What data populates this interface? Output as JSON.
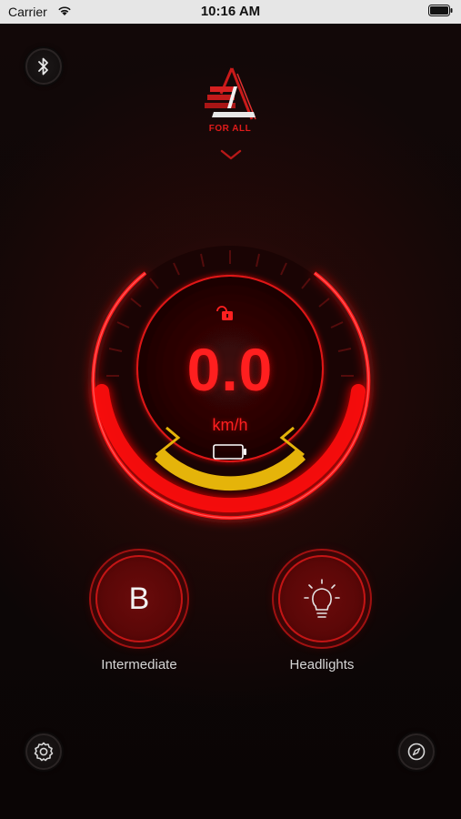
{
  "status_bar": {
    "carrier": "Carrier",
    "time": "10:16 AM"
  },
  "header": {
    "logo_text": "FOR ALL"
  },
  "speedometer": {
    "speed": "0.0",
    "unit": "km/h",
    "lock_state": "unlocked",
    "battery_level": 0.0
  },
  "controls": {
    "mode": {
      "letter": "B",
      "label": "Intermediate"
    },
    "headlights": {
      "label": "Headlights",
      "icon": "lightbulb-icon"
    }
  },
  "icons": {
    "top_left": "bluetooth-icon",
    "bottom_left": "settings-icon",
    "bottom_right": "compass-icon"
  },
  "colors": {
    "accent_red": "#ff1a1a",
    "battery_arc": "#e5b40a",
    "background": "#0b0505"
  }
}
